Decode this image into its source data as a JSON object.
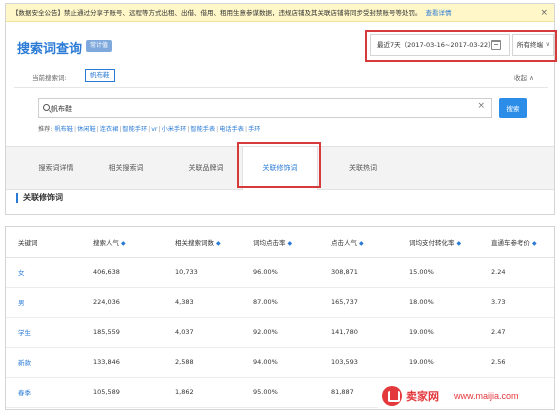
{
  "notice": {
    "text": "【数据安全公告】禁止通过分享子账号、远程等方式出租、出借、借用、租用生意参谋数据，违规店铺及其关联店铺将同步受封禁账号等处罚。",
    "link": "查看详情",
    "close": "×"
  },
  "header": {
    "title": "搜索词查询",
    "badge": "常计值",
    "date_range": "最近7天（2017-03-16~2017-03-22）",
    "terminal": "所有终端",
    "terminal_chevron": "∨"
  },
  "current": {
    "label": "当前搜索词:",
    "tag": "帆布鞋",
    "collapse": "收起 ∧"
  },
  "search": {
    "value": "帆布鞋",
    "placeholder": "",
    "clear": "×",
    "button": "搜索"
  },
  "recommend": {
    "label": "推荐:",
    "items": [
      "帆布鞋",
      "休闲鞋",
      "连衣裙",
      "智能手环",
      "vr",
      "小米手环",
      "智能手表",
      "电话手表",
      "手环"
    ]
  },
  "tabs": [
    {
      "label": "搜索词详情"
    },
    {
      "label": "相关搜索词"
    },
    {
      "label": "关联品牌词"
    },
    {
      "label": "关联修饰词"
    },
    {
      "label": "关联热词"
    }
  ],
  "active_tab": 3,
  "section_title": "关联修饰词",
  "table": {
    "sort_icon": "◆",
    "headers": [
      {
        "label": "关键词",
        "sortable": false
      },
      {
        "label": "搜索人气",
        "sortable": true
      },
      {
        "label": "相关搜索词数",
        "sortable": true
      },
      {
        "label": "词均点击率",
        "sortable": true
      },
      {
        "label": "点击人气",
        "sortable": true
      },
      {
        "label": "词均支付转化率",
        "sortable": true
      },
      {
        "label": "直通车参考价",
        "sortable": true
      }
    ],
    "rows": [
      [
        "女",
        "406,638",
        "10,733",
        "96.00%",
        "308,871",
        "15.00%",
        "2.24"
      ],
      [
        "男",
        "224,036",
        "4,383",
        "87.00%",
        "165,737",
        "18.00%",
        "3.73"
      ],
      [
        "学生",
        "185,559",
        "4,037",
        "92.00%",
        "141,780",
        "19.00%",
        "2.47"
      ],
      [
        "新款",
        "133,846",
        "2,588",
        "94.00%",
        "103,593",
        "19.00%",
        "2.56"
      ],
      [
        "春季",
        "105,589",
        "1,862",
        "95.00%",
        "81,887",
        "",
        ""
      ]
    ]
  },
  "watermark": {
    "cn": "卖家网",
    "url": "www.maijia.com"
  },
  "colors": {
    "accent": "#2b7bd6",
    "highlight": "#d63b3b",
    "notice_bg": "#fff7c8"
  }
}
